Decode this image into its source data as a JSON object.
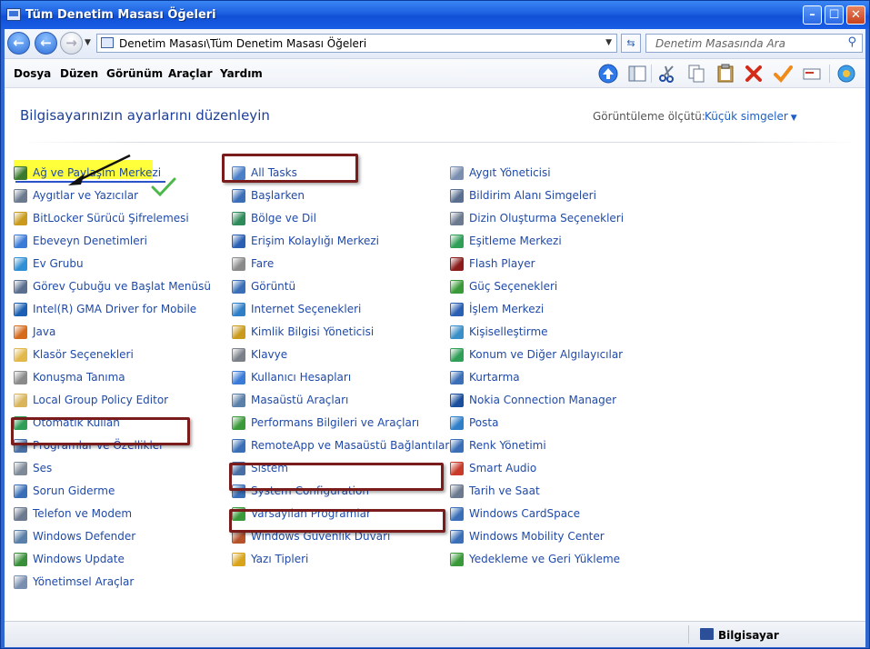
{
  "window": {
    "title": "Tüm Denetim Masası Öğeleri"
  },
  "address": {
    "path": "Denetim Masası\\Tüm Denetim Masası Öğeleri",
    "search_placeholder": "Denetim Masasında Ara"
  },
  "menu": [
    "Dosya",
    "Düzen",
    "Görünüm",
    "Araçlar",
    "Yardım"
  ],
  "toolbar_icons": [
    "up-icon",
    "panes-icon",
    "cut-icon",
    "copy-icon",
    "paste-icon",
    "delete-icon",
    "checkmark-icon",
    "rename-icon",
    "settings-icon"
  ],
  "heading": "Bilgisayarınızın ayarlarını düzenleyin",
  "view": {
    "label": "Görüntüleme ölçütü:",
    "value": "Küçük simgeler"
  },
  "columns": [
    [
      {
        "label": "Ağ ve Paylaşım Merkezi",
        "icon": "network-icon",
        "color": "#3a7a2e"
      },
      {
        "label": "Aygıtlar ve Yazıcılar",
        "icon": "printer-icon",
        "color": "#6b7a8f"
      },
      {
        "label": "BitLocker Sürücü Şifrelemesi",
        "icon": "bitlocker-icon",
        "color": "#c99a1b"
      },
      {
        "label": "Ebeveyn Denetimleri",
        "icon": "parental-icon",
        "color": "#3b7bd8"
      },
      {
        "label": "Ev Grubu",
        "icon": "homegroup-icon",
        "color": "#2f8fd6"
      },
      {
        "label": "Görev Çubuğu ve Başlat Menüsü",
        "icon": "taskbar-icon",
        "color": "#5a6f90"
      },
      {
        "label": "Intel(R) GMA Driver for Mobile",
        "icon": "intel-icon",
        "color": "#1a5fb4"
      },
      {
        "label": "Java",
        "icon": "java-icon",
        "color": "#d66a1b"
      },
      {
        "label": "Klasör Seçenekleri",
        "icon": "folder-icon",
        "color": "#e3b84a"
      },
      {
        "label": "Konuşma Tanıma",
        "icon": "microphone-icon",
        "color": "#8a8a8a"
      },
      {
        "label": "Local Group Policy Editor",
        "icon": "policy-icon",
        "color": "#d9b45a"
      },
      {
        "label": "Otomatik Kullan",
        "icon": "autoplay-icon",
        "color": "#2f9e57"
      },
      {
        "label": "Programlar ve Özellikler",
        "icon": "programs-icon",
        "color": "#4a6fa5"
      },
      {
        "label": "Ses",
        "icon": "speaker-icon",
        "color": "#7f8a99"
      },
      {
        "label": "Sorun Giderme",
        "icon": "troubleshoot-icon",
        "color": "#3a6fb8"
      },
      {
        "label": "Telefon ve Modem",
        "icon": "phone-icon",
        "color": "#6b7a8f"
      },
      {
        "label": "Windows Defender",
        "icon": "defender-icon",
        "color": "#5a7fa8"
      },
      {
        "label": "Windows Update",
        "icon": "update-icon",
        "color": "#3a8f3a"
      },
      {
        "label": "Yönetimsel Araçlar",
        "icon": "admin-tools-icon",
        "color": "#7a8fb0"
      }
    ],
    [
      {
        "label": "All Tasks",
        "icon": "all-tasks-icon",
        "color": "#4a7fc8"
      },
      {
        "label": "Başlarken",
        "icon": "getting-started-icon",
        "color": "#3a6fb8"
      },
      {
        "label": "Bölge ve Dil",
        "icon": "globe-icon",
        "color": "#2f8a5a"
      },
      {
        "label": "Erişim Kolaylığı Merkezi",
        "icon": "accessibility-icon",
        "color": "#2a5fb3"
      },
      {
        "label": "Fare",
        "icon": "mouse-icon",
        "color": "#8a8a8a"
      },
      {
        "label": "Görüntü",
        "icon": "display-icon",
        "color": "#3a6fb8"
      },
      {
        "label": "Internet Seçenekleri",
        "icon": "internet-icon",
        "color": "#2f7fc8"
      },
      {
        "label": "Kimlik Bilgisi Yöneticisi",
        "icon": "credential-icon",
        "color": "#c99a1b"
      },
      {
        "label": "Klavye",
        "icon": "keyboard-icon",
        "color": "#7a7f88"
      },
      {
        "label": "Kullanıcı Hesapları",
        "icon": "users-icon",
        "color": "#3b7bd8"
      },
      {
        "label": "Masaüstü Araçları",
        "icon": "gadgets-icon",
        "color": "#5a7fa8"
      },
      {
        "label": "Performans Bilgileri ve Araçları",
        "icon": "performance-icon",
        "color": "#3a9a3a"
      },
      {
        "label": "RemoteApp ve Masaüstü Bağlantıları",
        "icon": "remoteapp-icon",
        "color": "#3a6fb8"
      },
      {
        "label": "Sistem",
        "icon": "system-icon",
        "color": "#4a6fa5"
      },
      {
        "label": "System Configuration",
        "icon": "msconfig-icon",
        "color": "#3a6fb8"
      },
      {
        "label": "Varsayılan Programlar",
        "icon": "default-programs-icon",
        "color": "#3a9a3a"
      },
      {
        "label": "Windows Güvenlik Duvarı",
        "icon": "firewall-icon",
        "color": "#b5522a"
      },
      {
        "label": "Yazı Tipleri",
        "icon": "fonts-icon",
        "color": "#d9a41b"
      }
    ],
    [
      {
        "label": "Aygıt Yöneticisi",
        "icon": "device-manager-icon",
        "color": "#7a8fb0"
      },
      {
        "label": "Bildirim Alanı Simgeleri",
        "icon": "notification-icon",
        "color": "#5a6f90"
      },
      {
        "label": "Dizin Oluşturma Seçenekleri",
        "icon": "indexing-icon",
        "color": "#6b7a8f"
      },
      {
        "label": "Eşitleme Merkezi",
        "icon": "sync-icon",
        "color": "#2f9e57"
      },
      {
        "label": "Flash Player",
        "icon": "flash-icon",
        "color": "#8a1c1c"
      },
      {
        "label": "Güç Seçenekleri",
        "icon": "power-icon",
        "color": "#3a9a3a"
      },
      {
        "label": "İşlem Merkezi",
        "icon": "action-center-icon",
        "color": "#2a5fb3"
      },
      {
        "label": "Kişiselleştirme",
        "icon": "personalization-icon",
        "color": "#3a8fc8"
      },
      {
        "label": "Konum ve Diğer Algılayıcılar",
        "icon": "location-icon",
        "color": "#2f9e57"
      },
      {
        "label": "Kurtarma",
        "icon": "recovery-icon",
        "color": "#3a6fb8"
      },
      {
        "label": "Nokia Connection Manager",
        "icon": "nokia-icon",
        "color": "#1a4f9e"
      },
      {
        "label": "Posta",
        "icon": "mail-icon",
        "color": "#2f7fc8"
      },
      {
        "label": "Renk Yönetimi",
        "icon": "color-management-icon",
        "color": "#3a6fb8"
      },
      {
        "label": "Smart Audio",
        "icon": "audio-icon",
        "color": "#c83a2a"
      },
      {
        "label": "Tarih ve Saat",
        "icon": "clock-icon",
        "color": "#6b7a8f"
      },
      {
        "label": "Windows CardSpace",
        "icon": "cardspace-icon",
        "color": "#3a6fb8"
      },
      {
        "label": "Windows Mobility Center",
        "icon": "mobility-icon",
        "color": "#3a6fb8"
      },
      {
        "label": "Yedekleme ve Geri Yükleme",
        "icon": "backup-icon",
        "color": "#3a9a3a"
      }
    ]
  ],
  "status": {
    "computer": "Bilgisayar"
  }
}
